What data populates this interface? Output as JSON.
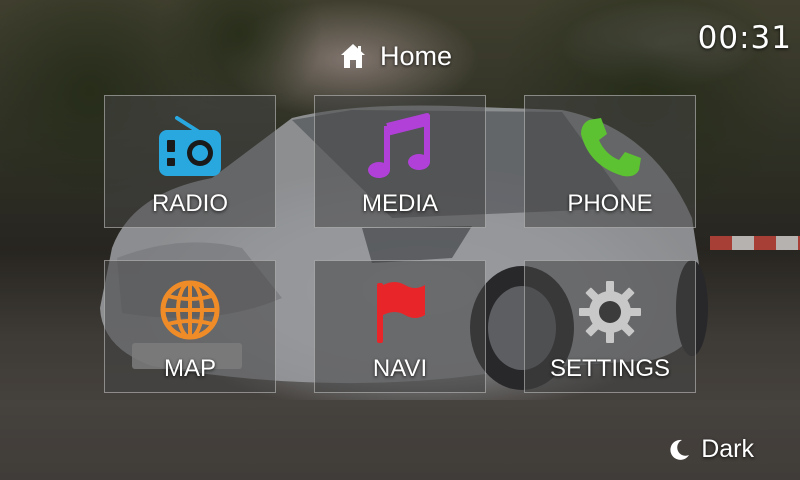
{
  "header": {
    "title": "Home",
    "icon": "home-icon",
    "clock": "00:31"
  },
  "tiles": [
    {
      "id": "radio",
      "label": "RADIO",
      "icon": "radio-icon",
      "color": "#29a8e0"
    },
    {
      "id": "media",
      "label": "MEDIA",
      "icon": "music-note-icon",
      "color": "#b040d8"
    },
    {
      "id": "phone",
      "label": "PHONE",
      "icon": "phone-icon",
      "color": "#5cc232"
    },
    {
      "id": "map",
      "label": "MAP",
      "icon": "globe-icon",
      "color": "#f08c28"
    },
    {
      "id": "navi",
      "label": "NAVI",
      "icon": "flag-icon",
      "color": "#e8262a"
    },
    {
      "id": "settings",
      "label": "SETTINGS",
      "icon": "gear-icon",
      "color": "#c8c8c8"
    }
  ],
  "footer": {
    "theme_toggle_label": "Dark",
    "theme_toggle_icon": "moon-icon"
  }
}
